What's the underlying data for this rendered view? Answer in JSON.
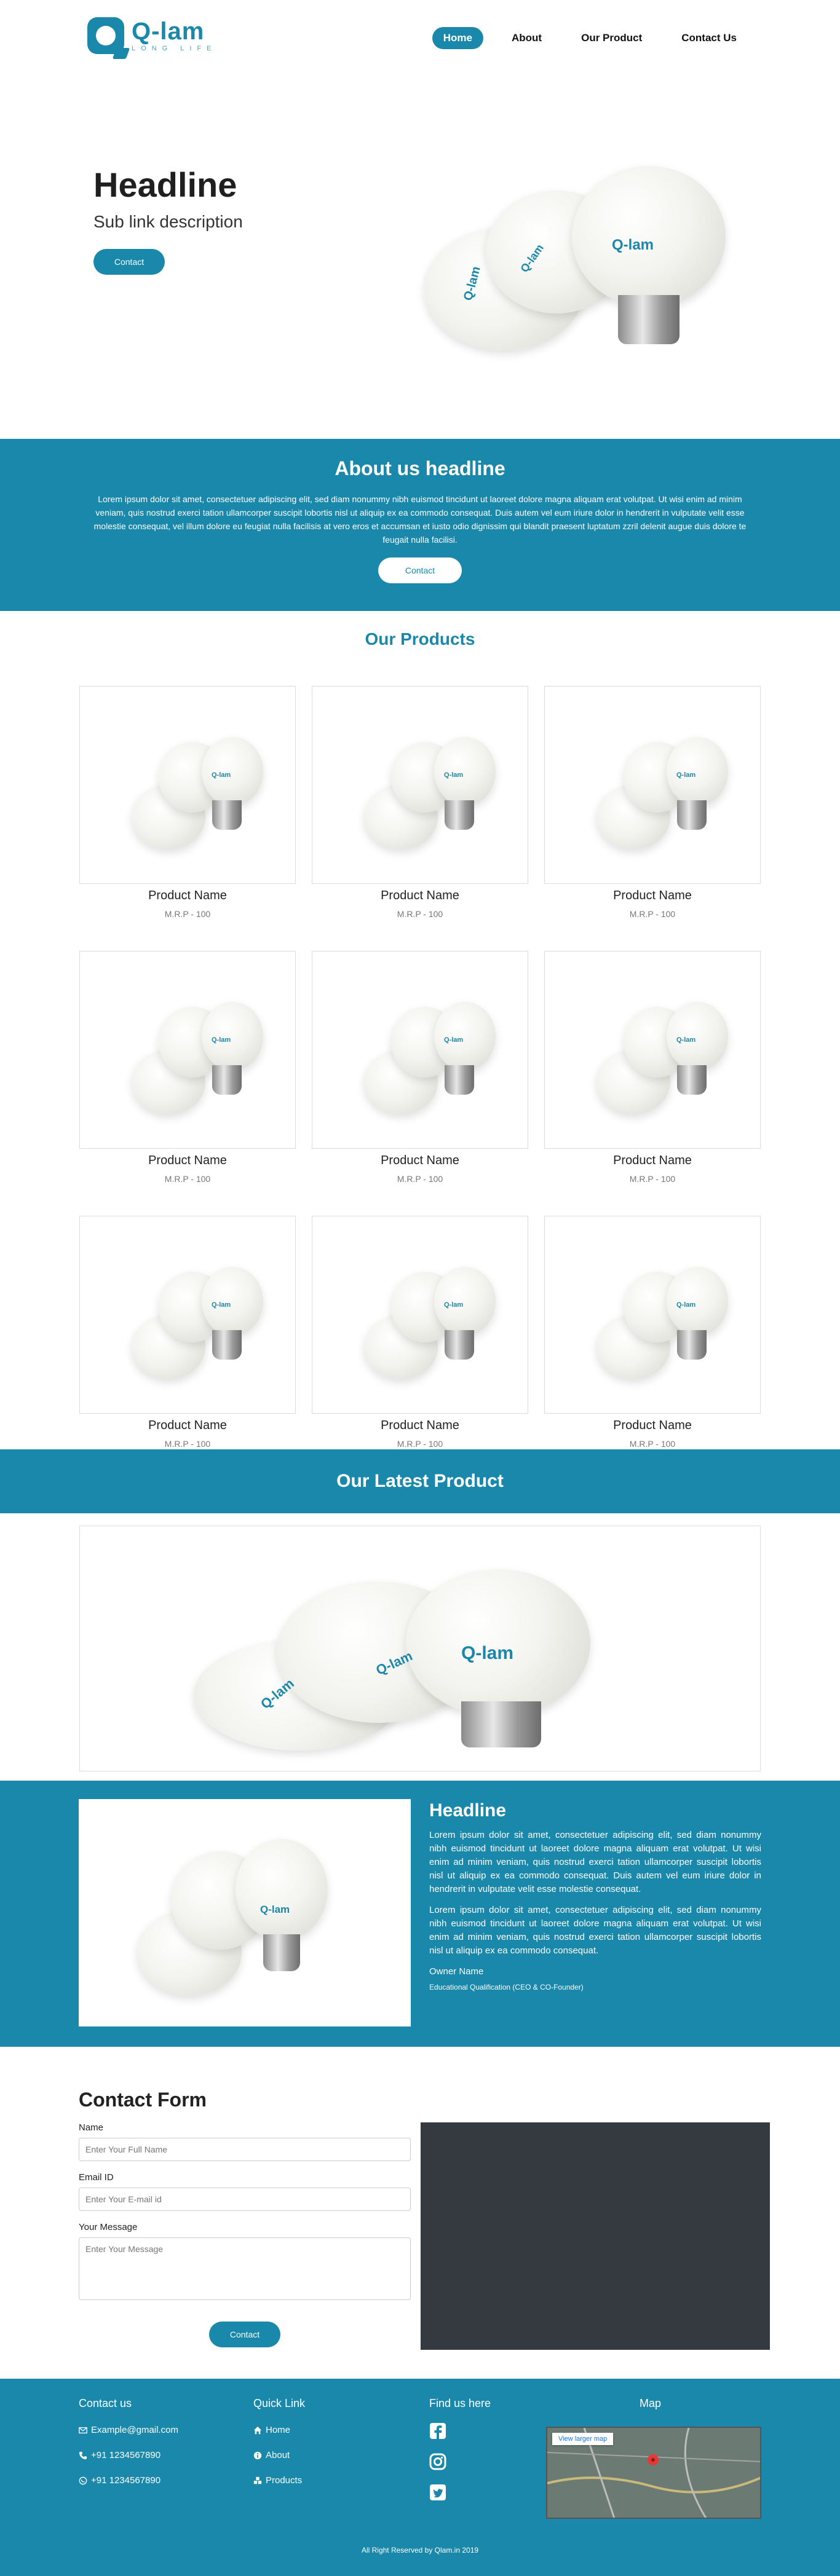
{
  "brand": {
    "name": "Q-lam",
    "tagline": "LONG LIFE",
    "bulb_brand": "Q-lam"
  },
  "nav": {
    "items": [
      "Home",
      "About",
      "Our Product",
      "Contact Us"
    ]
  },
  "hero": {
    "title": "Headline",
    "subtitle": "Sub link description",
    "button": "Contact"
  },
  "about": {
    "title": "About us headline",
    "text": "Lorem ipsum dolor sit amet, consectetuer adipiscing elit, sed diam nonummy nibh euismod tincidunt ut laoreet dolore magna aliquam erat volutpat. Ut wisi enim ad minim veniam, quis nostrud exerci tation ullamcorper suscipit lobortis nisl ut aliquip ex ea commodo consequat. Duis autem vel eum iriure dolor in hendrerit in vulputate velit esse molestie consequat, vel illum dolore eu feugiat nulla facilisis at vero eros et accumsan et iusto odio dignissim qui blandit praesent luptatum zzril delenit augue duis dolore te feugait nulla facilisi.",
    "button": "Contact"
  },
  "products": {
    "title": "Our Products",
    "items": [
      {
        "name": "Product Name",
        "price": "M.R.P - 100"
      },
      {
        "name": "Product Name",
        "price": "M.R.P - 100"
      },
      {
        "name": "Product Name",
        "price": "M.R.P - 100"
      },
      {
        "name": "Product Name",
        "price": "M.R.P - 100"
      },
      {
        "name": "Product Name",
        "price": "M.R.P - 100"
      },
      {
        "name": "Product Name",
        "price": "M.R.P - 100"
      },
      {
        "name": "Product Name",
        "price": "M.R.P - 100"
      },
      {
        "name": "Product Name",
        "price": "M.R.P - 100"
      },
      {
        "name": "Product Name",
        "price": "M.R.P - 100"
      }
    ]
  },
  "latest": {
    "title": "Our Latest Product"
  },
  "feature": {
    "title": "Headline",
    "para1": "Lorem ipsum dolor sit amet, consectetuer adipiscing elit, sed diam nonummy nibh euismod tincidunt ut laoreet dolore magna aliquam erat volutpat. Ut wisi enim ad minim veniam, quis nostrud exerci tation ullamcorper suscipit lobortis nisl ut aliquip ex ea commodo consequat. Duis autem vel eum iriure dolor in hendrerit in vulputate velit esse molestie consequat.",
    "para2": "Lorem ipsum dolor sit amet, consectetuer adipiscing elit, sed diam nonummy nibh euismod tincidunt ut laoreet dolore magna aliquam erat volutpat. Ut wisi enim ad minim veniam, quis nostrud exerci tation ullamcorper suscipit lobortis nisl ut aliquip ex ea commodo consequat.",
    "owner": "Owner Name",
    "qualification": "Educational Qualification (CEO & CO-Founder)"
  },
  "contact": {
    "title": "Contact Form",
    "name_label": "Name",
    "name_placeholder": "Enter Your Full Name",
    "email_label": "Email ID",
    "email_placeholder": "Enter Your E-mail id",
    "message_label": "Your Message",
    "message_placeholder": "Enter Your Message",
    "button": "Contact"
  },
  "footer": {
    "contact_title": "Contact us",
    "email": "Example@gmail.com",
    "phone": "+91 1234567890",
    "whatsapp": "+91 1234567890",
    "quick_title": "Quick Link",
    "links": [
      "Home",
      "About",
      "Products"
    ],
    "find_title": "Find us here",
    "socials": [
      "facebook-icon",
      "instagram-icon",
      "twitter-icon"
    ],
    "map_title": "Map",
    "map_link": "View larger map",
    "copyright": "All Right Reserved by Qlam.in 2019"
  },
  "colors": {
    "accent": "#1a88ab",
    "dark": "#343a40"
  }
}
